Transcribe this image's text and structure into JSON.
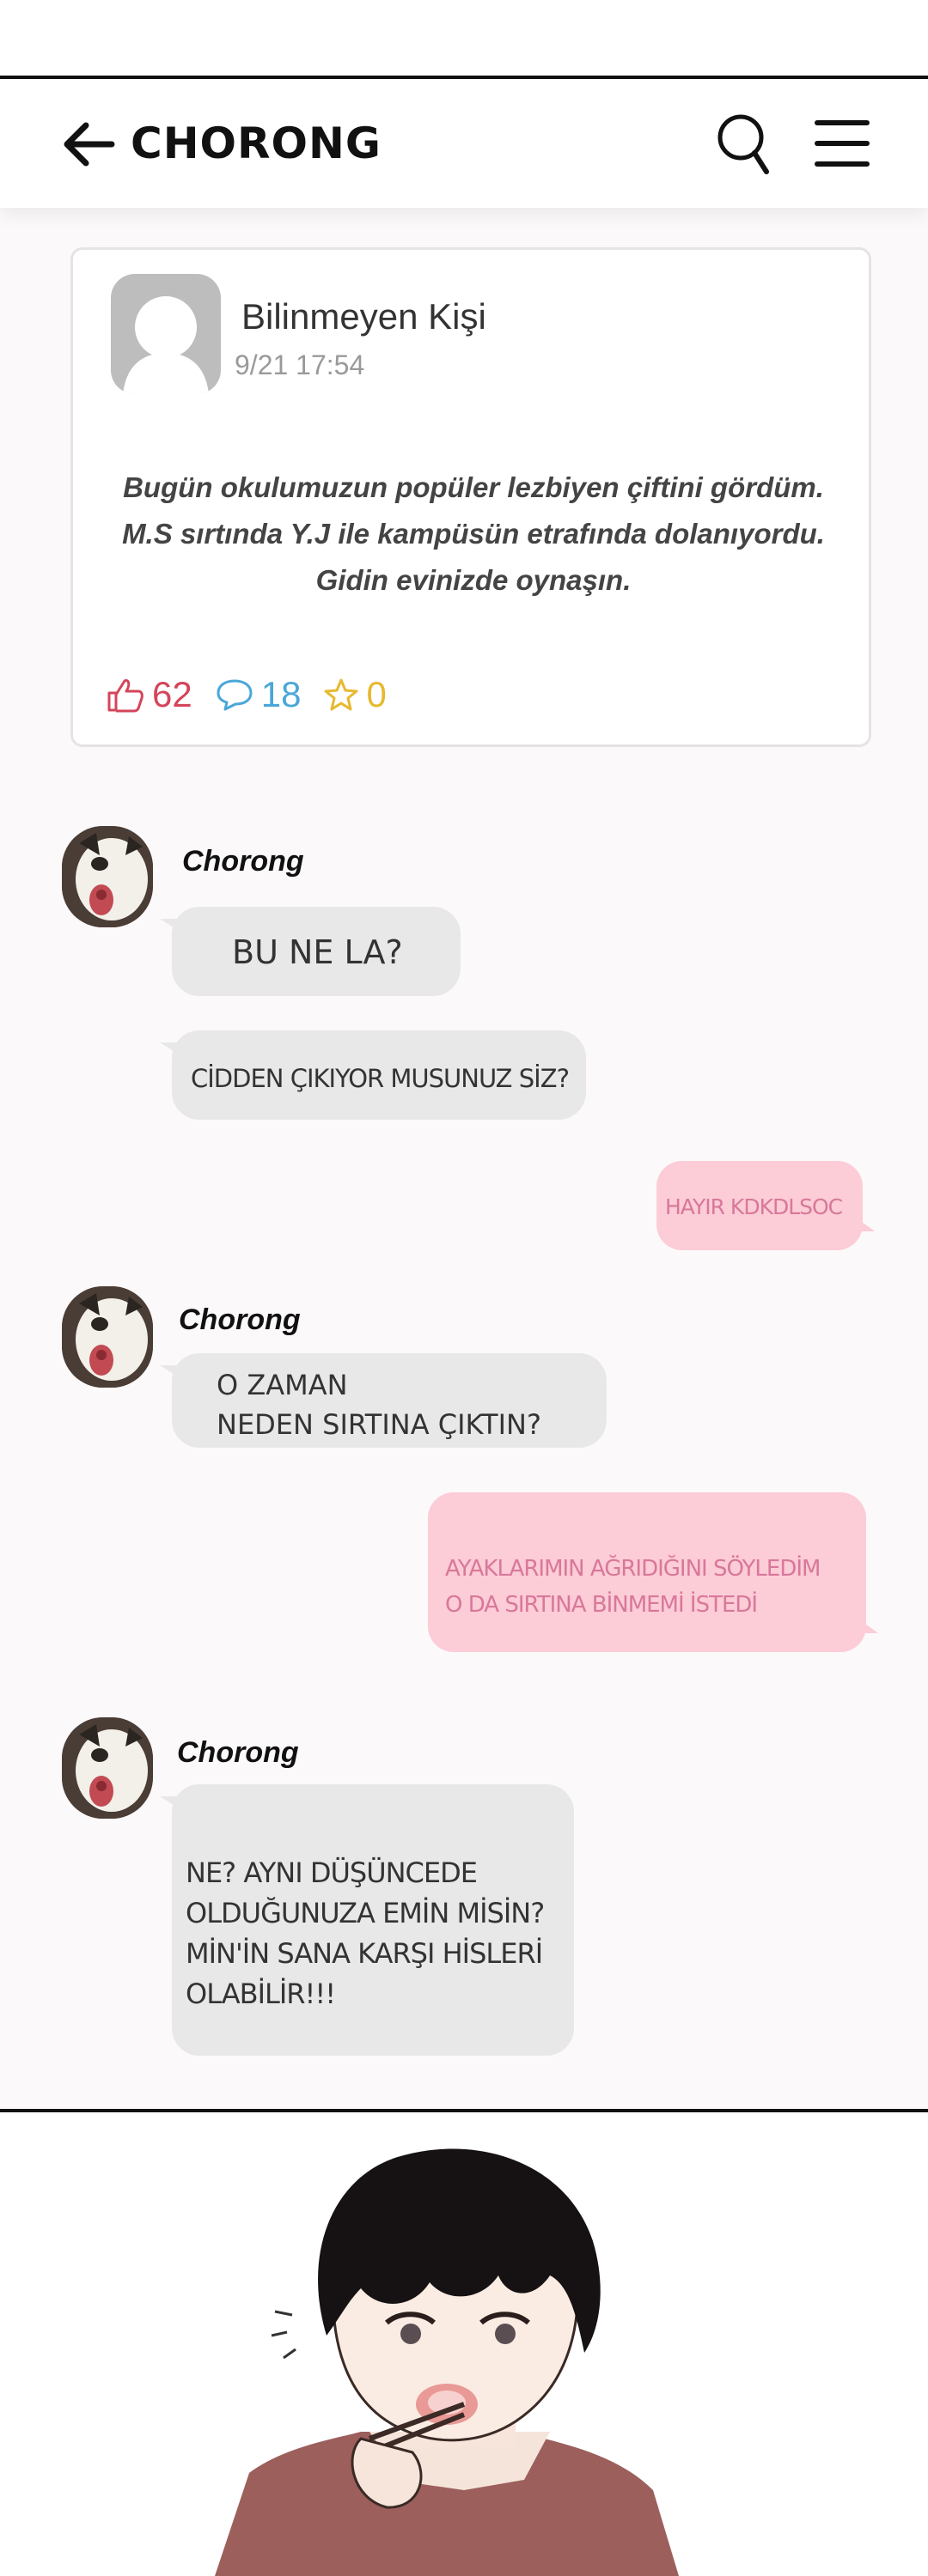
{
  "header": {
    "title": "CHORONG",
    "back_icon": "arrow-left-icon",
    "search_icon": "search-icon",
    "menu_icon": "hamburger-menu-icon"
  },
  "post": {
    "author": "Bilinmeyen Kişi",
    "time": "9/21 17:54",
    "body_lines": [
      "Bugün okulumuzun popüler lezbiyen çiftini gördüm.",
      "M.S sırtında Y.J ile kampüsün etrafında dolanıyordu.",
      "Gidin evinizde oynaşın."
    ],
    "likes": "62",
    "comments": "18",
    "stars": "0"
  },
  "chat": {
    "sender1": "Chorong",
    "msg1": "BU NE LA?",
    "msg2": "CİDDEN ÇIKIYOR MUSUNUZ SİZ?",
    "reply1": "HAYIR KDKDLSOC",
    "sender2": "Chorong",
    "msg3_lines": [
      "O ZAMAN",
      "NEDEN SIRTINA ÇIKTIN?"
    ],
    "reply2_lines": [
      "AYAKLARIMIN AĞRIDIĞINI SÖYLEDİM",
      "O DA SIRTINA BİNMEMİ İSTEDİ"
    ],
    "sender3": "Chorong",
    "msg4_lines": [
      "NE? AYNI DÜŞÜNCEDE",
      "OLDUĞUNUZA EMİN MİSİN?",
      "MİN'İN SANA KARŞI HİSLERİ",
      "OLABİLİR!!!"
    ]
  },
  "colors": {
    "incoming_bubble": "#e9e8e8",
    "outgoing_bubble": "#fcccd7",
    "outgoing_text": "#d8789a",
    "likes": "#d4455a",
    "comments": "#4aa7d8",
    "stars": "#e7b92e"
  }
}
